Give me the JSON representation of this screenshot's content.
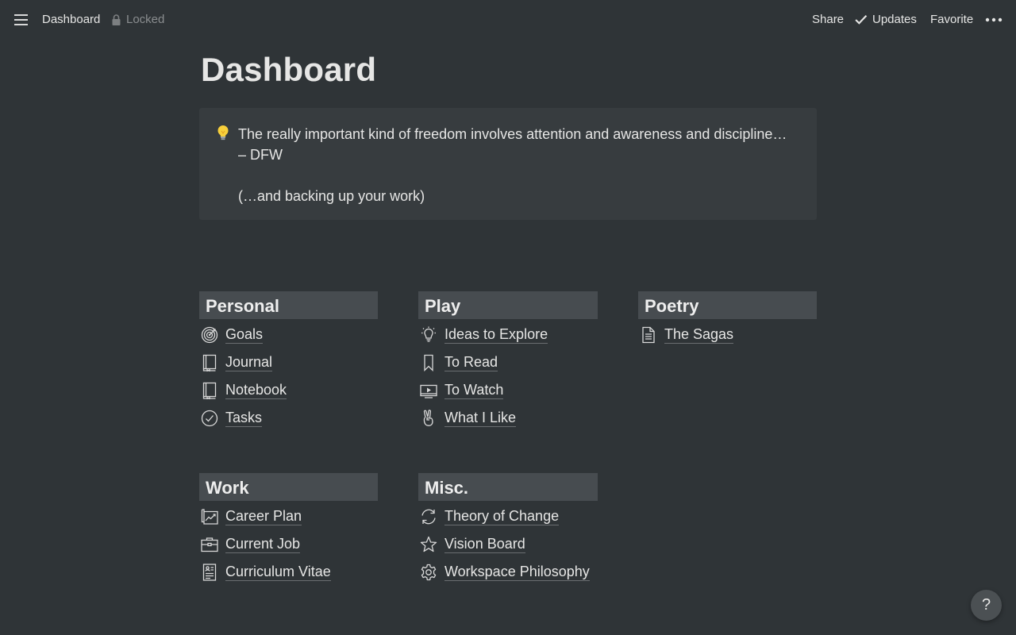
{
  "topbar": {
    "breadcrumb": "Dashboard",
    "locked_label": "Locked",
    "share_label": "Share",
    "updates_label": "Updates",
    "favorite_label": "Favorite"
  },
  "page": {
    "title": "Dashboard",
    "callout": {
      "icon": "lightbulb-emoji",
      "line1": "The really important kind of freedom involves attention and awareness and discipline…",
      "line2": "– DFW",
      "line3": "(…and backing up your work)"
    }
  },
  "sections": {
    "personal": {
      "heading": "Personal",
      "items": [
        {
          "label": "Goals",
          "icon": "target-icon"
        },
        {
          "label": "Journal",
          "icon": "notebook-icon"
        },
        {
          "label": "Notebook",
          "icon": "notebook-icon"
        },
        {
          "label": "Tasks",
          "icon": "check-circle-icon"
        }
      ]
    },
    "play": {
      "heading": "Play",
      "items": [
        {
          "label": "Ideas to Explore",
          "icon": "lightbulb-icon"
        },
        {
          "label": "To Read",
          "icon": "bookmark-icon"
        },
        {
          "label": "To Watch",
          "icon": "video-icon"
        },
        {
          "label": "What I Like",
          "icon": "peace-hand-icon"
        }
      ]
    },
    "poetry": {
      "heading": "Poetry",
      "items": [
        {
          "label": "The Sagas",
          "icon": "document-icon"
        }
      ]
    },
    "work": {
      "heading": "Work",
      "items": [
        {
          "label": "Career Plan",
          "icon": "chart-map-icon"
        },
        {
          "label": "Current Job",
          "icon": "briefcase-icon"
        },
        {
          "label": "Curriculum Vitae",
          "icon": "resume-icon"
        }
      ]
    },
    "misc": {
      "heading": "Misc.",
      "items": [
        {
          "label": "Theory of Change",
          "icon": "refresh-icon"
        },
        {
          "label": "Vision Board",
          "icon": "star-icon"
        },
        {
          "label": "Workspace Philosophy",
          "icon": "gear-icon"
        }
      ]
    }
  },
  "help": {
    "label": "?"
  }
}
